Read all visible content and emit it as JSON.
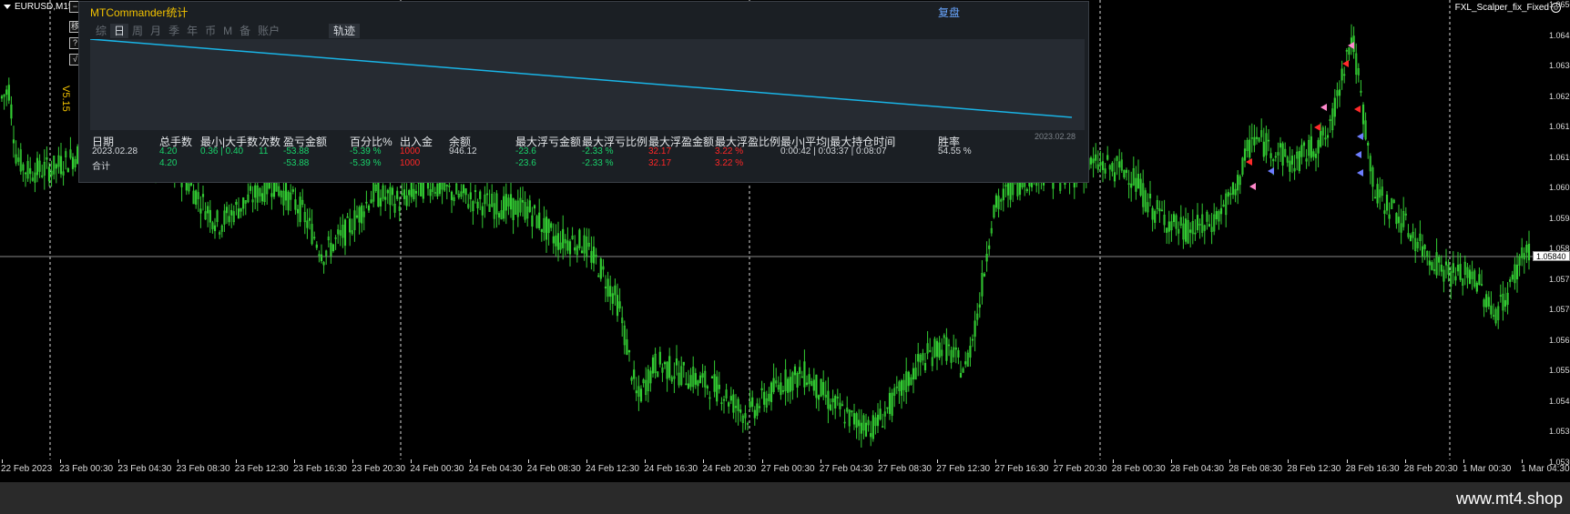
{
  "chart": {
    "symbol": "EURUSD,M15",
    "ea_name": "FXL_Scalper_fix_Fixed",
    "ea_face": "☺",
    "current_price": "1.05840",
    "price_ticks": [
      "1.06505",
      "1.06425",
      "1.06345",
      "1.06265",
      "1.06185",
      "1.06105",
      "1.06025",
      "1.05945",
      "1.05865",
      "1.05785",
      "1.05705",
      "1.05625",
      "1.05545",
      "1.05465",
      "1.05385",
      "1.05305"
    ],
    "time_ticks": [
      "22 Feb 2023",
      "23 Feb 00:30",
      "23 Feb 04:30",
      "23 Feb 08:30",
      "23 Feb 12:30",
      "23 Feb 16:30",
      "23 Feb 20:30",
      "24 Feb 00:30",
      "24 Feb 04:30",
      "24 Feb 08:30",
      "24 Feb 12:30",
      "24 Feb 16:30",
      "24 Feb 20:30",
      "27 Feb 00:30",
      "27 Feb 04:30",
      "27 Feb 08:30",
      "27 Feb 12:30",
      "27 Feb 16:30",
      "27 Feb 20:30",
      "28 Feb 00:30",
      "28 Feb 04:30",
      "28 Feb 08:30",
      "28 Feb 12:30",
      "28 Feb 16:30",
      "28 Feb 20:30",
      "1 Mar 00:30",
      "1 Mar 04:30"
    ],
    "candle_color": "#33cc33",
    "background": "#000000"
  },
  "side_buttons": {
    "minimize": "−",
    "btn1": "移",
    "btn2": "?",
    "btn3": "√"
  },
  "version": "V5.15",
  "panel": {
    "title": "MTCommander统计",
    "right_label": "复盘",
    "tabs": [
      "综",
      "日",
      "周",
      "月",
      "季",
      "年",
      "币",
      "M",
      "备",
      "账户"
    ],
    "active_tab": "日",
    "track_tab": "轨迹",
    "mini_chart_date": "2023.02.28",
    "line_color": "#19b4e6",
    "headers": [
      "日期",
      "总手数",
      "最小|大手数",
      "次数",
      "盈亏金额",
      "百分比%",
      "出入金",
      "余额",
      "最大浮亏金额",
      "最大浮亏比例",
      "最大浮盈金额",
      "最大浮盈比例",
      "最小|平均|最大持仓时间",
      "胜率"
    ],
    "rows": [
      [
        "2023.02.28",
        "4.20",
        "0.36 | 0.40",
        "11",
        "-53.88",
        "-5.39 %",
        "1000",
        "946.12",
        "-23.6",
        "-2.33 %",
        "32.17",
        "3.22 %",
        "0:00:42 | 0:03:37 | 0:08:07",
        "54.55 %"
      ],
      [
        "合计",
        "4.20",
        "",
        "",
        "-53.88",
        "-5.39 %",
        "1000",
        "",
        "-23.6",
        "-2.33 %",
        "32.17",
        "3.22 %",
        "",
        ""
      ]
    ]
  },
  "footer": {
    "brand": "www.mt4.shop"
  }
}
